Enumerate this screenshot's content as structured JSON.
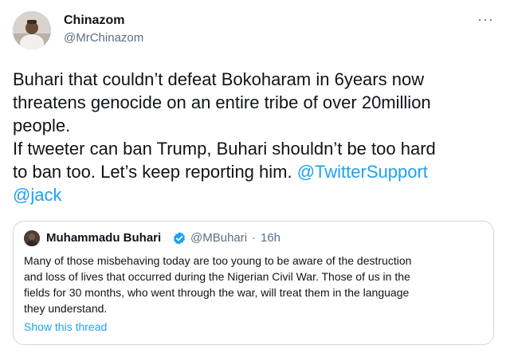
{
  "tweet": {
    "author": {
      "name": "Chinazom",
      "handle": "@MrChinazom",
      "avatar_icon": "profile-photo"
    },
    "more_icon": "more-options-icon",
    "text_lines": [
      "Buhari that couldn’t defeat Bokoharam in 6years now",
      "threatens genocide on an entire tribe of over 20million",
      "people.",
      "If tweeter can ban Trump, Buhari shouldn’t be too hard",
      "to ban too. Let’s keep reporting him. "
    ],
    "mentions": [
      "@TwitterSupport",
      "@jack"
    ]
  },
  "quoted_tweet": {
    "author": {
      "name": "Muhammadu Buhari",
      "handle": "@MBuhari",
      "verified": true
    },
    "separator": "·",
    "time": "16h",
    "text_lines": [
      "Many of those misbehaving today are too young to be aware of the destruction",
      "and loss of lives that occurred during the Nigerian Civil War. Those of us in the",
      "fields for 30 months, who went through the war, will treat them in the language",
      "they understand."
    ],
    "show_thread_label": "Show this thread"
  },
  "colors": {
    "link": "#1da1f2",
    "secondary_text": "#5b7083",
    "primary_text": "#0f1419",
    "border": "#cfd9de",
    "verified": "#1da1f2"
  }
}
